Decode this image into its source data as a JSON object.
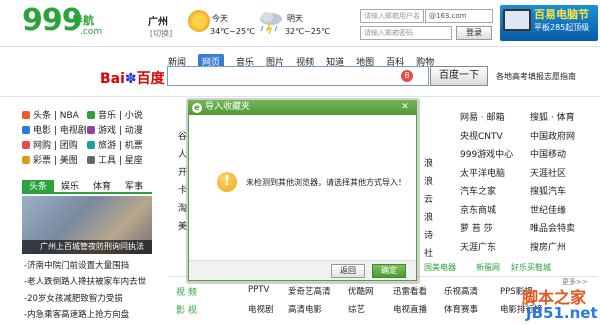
{
  "header": {
    "logo_num": "999",
    "logo_text": "导航",
    "logo_com": ".com",
    "city": "广州",
    "switch": "[切换]",
    "weather": [
      {
        "day": "今天",
        "temp": "34℃~25℃",
        "icon": "sun-icon"
      },
      {
        "day": "明天",
        "temp": "32℃~25℃",
        "icon": "thunderstorm-icon"
      }
    ],
    "email_placeholder": "请输入邮箱用户名",
    "email_domain": "@163.com",
    "password_placeholder": "请输入邮箱密码",
    "login": "登录",
    "ad_title": "百易电脑节",
    "ad_sub": "平板285起顶级"
  },
  "search": {
    "tabs": [
      "新闻",
      "网页",
      "音乐",
      "图片",
      "视频",
      "知道",
      "地图",
      "百科",
      "购物"
    ],
    "active": "网页",
    "brand_a": "Bai",
    "brand_b": "百度",
    "button": "百度一下",
    "link": "各地高考填报志愿指南"
  },
  "sidebar": {
    "rows": [
      [
        {
          "label": "头条 | NBA",
          "color": "#e85d2b"
        },
        {
          "label": "音乐 | 小说",
          "color": "#2aa33a"
        }
      ],
      [
        {
          "label": "电影 | 电视剧",
          "color": "#2a7be0"
        },
        {
          "label": "游戏 | 动漫",
          "color": "#8e44ad"
        }
      ],
      [
        {
          "label": "网购 | 团购",
          "color": "#e84a4a"
        },
        {
          "label": "旅游 | 机票",
          "color": "#1aa1a1"
        }
      ],
      [
        {
          "label": "彩票 | 美图",
          "color": "#d4a017"
        },
        {
          "label": "工具 | 星座",
          "color": "#666666"
        }
      ]
    ],
    "tabs": [
      "头条",
      "娱乐",
      "体育",
      "军事"
    ],
    "caption": "广州上百城管夜防刑询问执法",
    "news": [
      "-济南中院门前设置大量围挡",
      "-老人跌倒路人搀扶被家车内去世",
      "-20岁女孩减肥致智力受损",
      "-内急乘客高速路上抢方向盘"
    ]
  },
  "sites": {
    "right_rows": [
      [
        "网易 · 邮箱",
        "搜狐 · 体育"
      ],
      [
        "央视CNTV",
        "中国政府网"
      ],
      [
        "999游戏中心",
        "中国移动"
      ],
      [
        "太平洋电脑",
        "天涯社区"
      ],
      [
        "汽车之家",
        "搜狐汽车"
      ],
      [
        "京东商城",
        "世纪佳缘"
      ],
      [
        "萝 苔 莎",
        "唯品会特卖"
      ],
      [
        "天涯广东",
        "搜房广州"
      ]
    ],
    "left_frag": [
      "谷",
      "人",
      "开",
      "卡",
      "淘",
      "美"
    ],
    "mid_frag": [
      "浪",
      "浪",
      "云",
      "浪",
      "诗",
      "社"
    ],
    "bottom_links": [
      "国美电器",
      "新蛋网",
      "好乐买鞋城"
    ]
  },
  "categories": [
    {
      "label": "视 频",
      "items": [
        "PPTV",
        "爱奇艺高清",
        "优酷网",
        "迅雷看看",
        "乐视高清",
        "PPS影视"
      ]
    },
    {
      "label": "影 视",
      "items": [
        "电视剧",
        "高清电影",
        "综艺",
        "电视直播",
        "体育赛事",
        "电影排行榜"
      ]
    }
  ],
  "dialog": {
    "title": "导入收藏夹",
    "logo": "e",
    "message": "未检测到其他浏览器，请选择其他方式导入！",
    "back": "返回",
    "ok": "确定"
  },
  "watermark": {
    "line1": "脚本之家",
    "line2": "JB51.net",
    "more": "更多>>"
  }
}
